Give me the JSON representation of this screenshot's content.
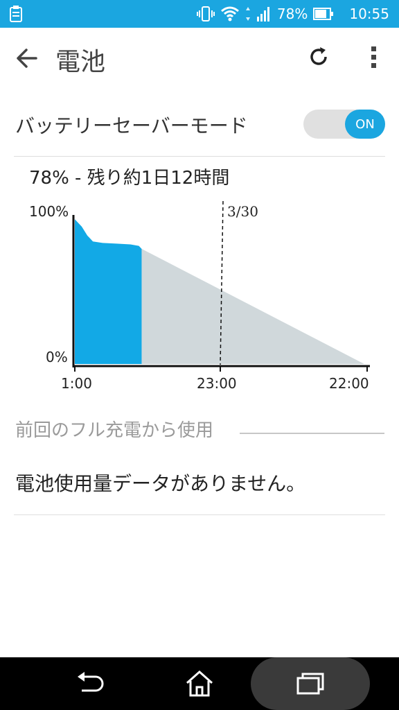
{
  "status_bar": {
    "battery_percent": "78%",
    "time": "10:55"
  },
  "app_bar": {
    "title": "電池"
  },
  "battery_saver": {
    "label": "バッテリーセーバーモード",
    "toggle_state": "ON"
  },
  "summary": {
    "remaining_text": "78% - 残り約1日12時間"
  },
  "chart_data": {
    "type": "area",
    "y_tick_labels": [
      "100%",
      "0%"
    ],
    "x_tick_labels": [
      "1:00",
      "23:00",
      "22:00"
    ],
    "annotation": "3/30",
    "actual_series": {
      "x_hours": [
        0,
        0.2,
        0.5,
        0.9,
        1.3,
        2.0,
        3.0,
        4.0,
        4.6,
        4.8
      ],
      "y_percent": [
        98,
        96,
        93,
        87,
        83,
        82,
        81.5,
        81,
        80,
        78
      ]
    },
    "projected_series": {
      "x_hours": [
        4.8,
        20.8
      ],
      "y_percent": [
        78,
        0
      ]
    },
    "xlim_hours": [
      0,
      21
    ],
    "ylim": [
      0,
      100
    ],
    "colors": {
      "actual": "#12a9e6",
      "projected": "#d0d8db"
    }
  },
  "usage_section": {
    "header": "前回のフル充電から使用",
    "empty_message": "電池使用量データがありません。"
  }
}
